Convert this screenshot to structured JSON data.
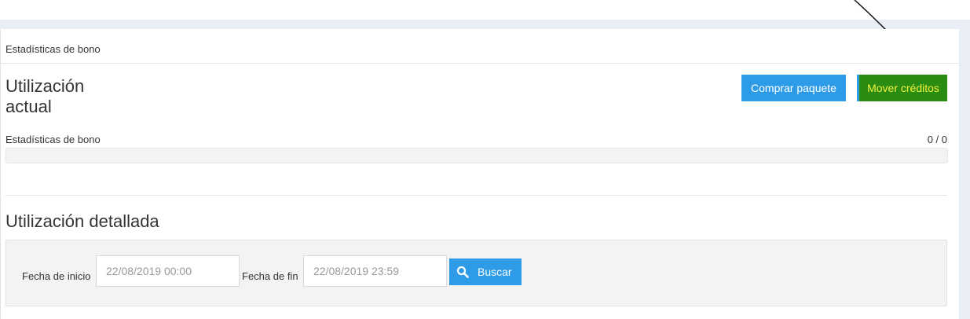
{
  "panel": {
    "header_title": "Estadísticas de bono"
  },
  "usage": {
    "title": "Utilización actual",
    "buy_package_label": "Comprar paquete",
    "move_credits_label": "Mover créditos",
    "stats_label": "Estadísticas de bono",
    "count": "0 / 0",
    "progress_fraction": 0
  },
  "detailed": {
    "title": "Utilización detallada",
    "start_label": "Fecha de inicio",
    "start_value": "22/08/2019 00:00",
    "end_label": "Fecha de fin",
    "end_value": "22/08/2019 23:59",
    "search_label": "Buscar",
    "search_icon": "search-icon"
  },
  "colors": {
    "accent": "#2d9be8",
    "highlight_button": "#2b8c13",
    "highlight_text": "#f1f13a"
  }
}
